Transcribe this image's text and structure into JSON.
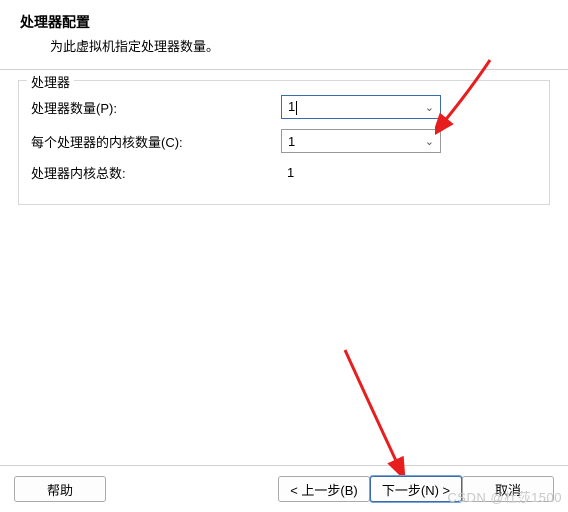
{
  "header": {
    "title": "处理器配置",
    "subtitle": "为此虚拟机指定处理器数量。"
  },
  "fieldset": {
    "legend": "处理器",
    "rows": {
      "processor_count": {
        "label": "处理器数量(P):",
        "value": "1"
      },
      "cores_per": {
        "label": "每个处理器的内核数量(C):",
        "value": "1"
      },
      "total_cores": {
        "label": "处理器内核总数:",
        "value": "1"
      }
    }
  },
  "buttons": {
    "help": "帮助",
    "back": "< 上一步(B)",
    "next": "下一步(N) >",
    "cancel": "取消"
  },
  "watermark": "CSDN @杜莎1500"
}
